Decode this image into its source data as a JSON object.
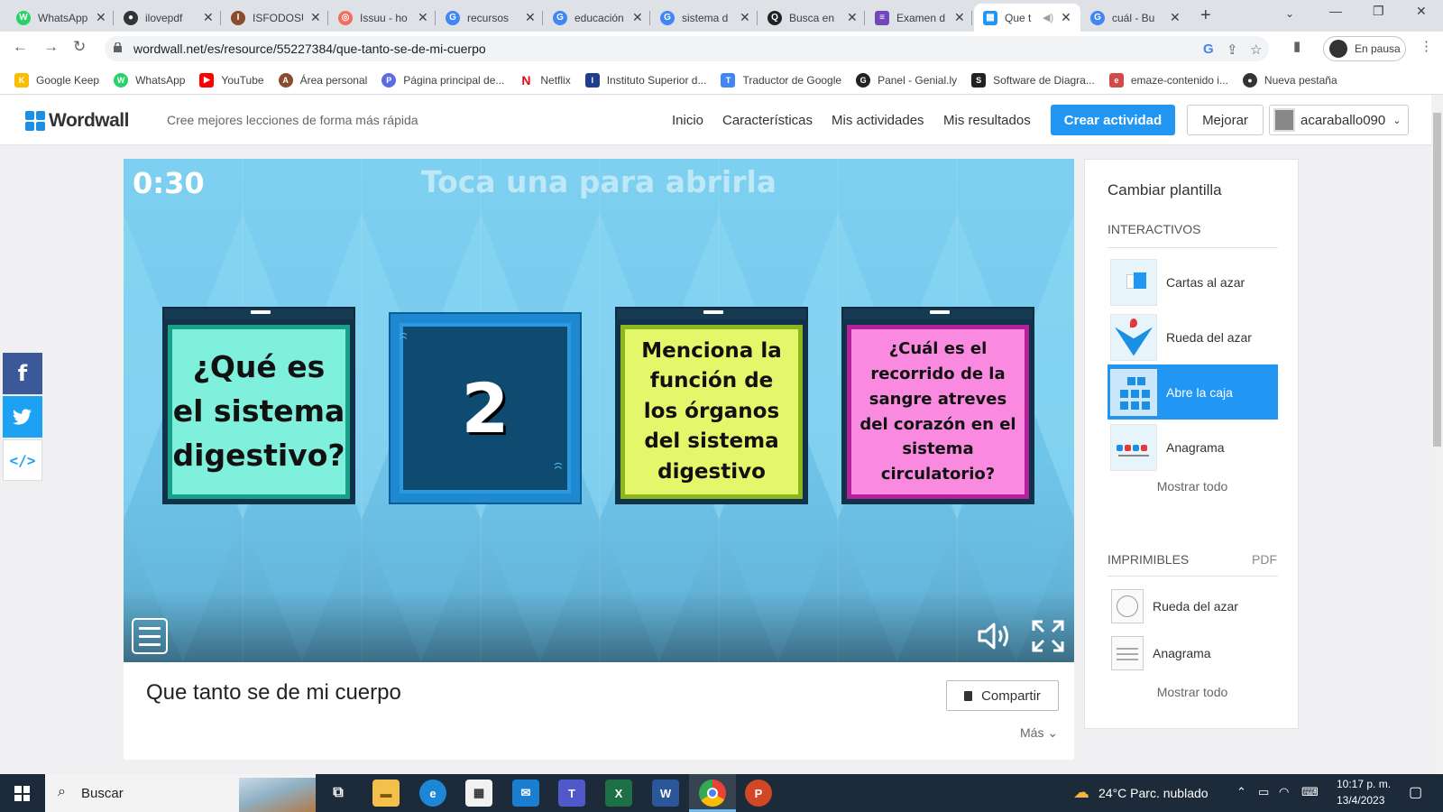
{
  "browser": {
    "tabs": [
      {
        "title": "WhatsApp",
        "color": "#25d366",
        "glyph": "W"
      },
      {
        "title": "ilovepdf",
        "color": "#333333",
        "glyph": "●"
      },
      {
        "title": "ISFODOSU",
        "color": "#8a4b2f",
        "glyph": "I"
      },
      {
        "title": "Issuu - ho",
        "color": "#f36d5d",
        "glyph": "◎"
      },
      {
        "title": "recursos",
        "color": "#4285f4",
        "glyph": "G"
      },
      {
        "title": "educación",
        "color": "#4285f4",
        "glyph": "G"
      },
      {
        "title": "sistema d",
        "color": "#4285f4",
        "glyph": "G"
      },
      {
        "title": "Busca en",
        "color": "#222222",
        "glyph": "Q"
      },
      {
        "title": "Examen d",
        "color": "#7248b9",
        "glyph": "≡"
      },
      {
        "title": "Que t",
        "color": "#2196f3",
        "glyph": "▦"
      },
      {
        "title": "cuál - Bu",
        "color": "#4285f4",
        "glyph": "G"
      }
    ],
    "url": "wordwall.net/es/resource/55227384/que-tanto-se-de-mi-cuerpo",
    "profile_label": "En pausa",
    "bookmarks": [
      {
        "label": "Google Keep",
        "color": "#fbbc04",
        "glyph": "K"
      },
      {
        "label": "WhatsApp",
        "color": "#25d366",
        "glyph": "W"
      },
      {
        "label": "YouTube",
        "color": "#ff0000",
        "glyph": "▶"
      },
      {
        "label": "Área personal",
        "color": "#8a4b2f",
        "glyph": "A"
      },
      {
        "label": "Página principal de...",
        "color": "#5b6ee1",
        "glyph": "P"
      },
      {
        "label": "Netflix",
        "color": "#e50914",
        "glyph": "N"
      },
      {
        "label": "Instituto Superior d...",
        "color": "#1d3f8c",
        "glyph": "I"
      },
      {
        "label": "Traductor de Google",
        "color": "#4285f4",
        "glyph": "T"
      },
      {
        "label": "Panel - Genial.ly",
        "color": "#222222",
        "glyph": "G"
      },
      {
        "label": "Software de Diagra...",
        "color": "#222222",
        "glyph": "S"
      },
      {
        "label": "emaze-contenido i...",
        "color": "#d14b4b",
        "glyph": "e"
      },
      {
        "label": "Nueva pestaña",
        "color": "#333333",
        "glyph": "●"
      }
    ]
  },
  "header": {
    "logo": "Wordwall",
    "tagline": "Cree mejores lecciones de forma más rápida",
    "nav": [
      "Inicio",
      "Características",
      "Mis actividades",
      "Mis resultados"
    ],
    "create_label": "Crear actividad",
    "upgrade_label": "Mejorar",
    "username": "acaraballo090"
  },
  "game": {
    "timer": "0:30",
    "instruction": "Toca una para abrirla",
    "boxes": [
      {
        "text": "¿Qué es el sistema digestivo?",
        "bg": "#7ef0dc",
        "border": "#19a08a"
      },
      {
        "text": "Menciona la función de los órganos del sistema digestivo",
        "bg": "#e4f76a",
        "border": "#8cb61f"
      },
      {
        "text": "¿Cuál es el recorrido de la sangre atreves del corazón en el sistema circulatorio?",
        "bg": "#f98ae0",
        "border": "#b3209a"
      }
    ],
    "closed_number": "2"
  },
  "activity": {
    "title": "Que tanto se de mi cuerpo",
    "share_label": "Compartir",
    "more_label": "Más"
  },
  "panel": {
    "title": "Cambiar plantilla",
    "interactive_label": "INTERACTIVOS",
    "interactive": [
      "Cartas al azar",
      "Rueda del azar",
      "Abre la caja",
      "Anagrama"
    ],
    "selected": "Abre la caja",
    "show_all": "Mostrar todo",
    "printable_label": "IMPRIMIBLES",
    "pdf_label": "PDF",
    "printable": [
      "Rueda del azar",
      "Anagrama"
    ]
  },
  "taskbar": {
    "search_placeholder": "Buscar",
    "weather": "24°C  Parc. nublado",
    "time": "10:17 p. m.",
    "date": "13/4/2023"
  }
}
